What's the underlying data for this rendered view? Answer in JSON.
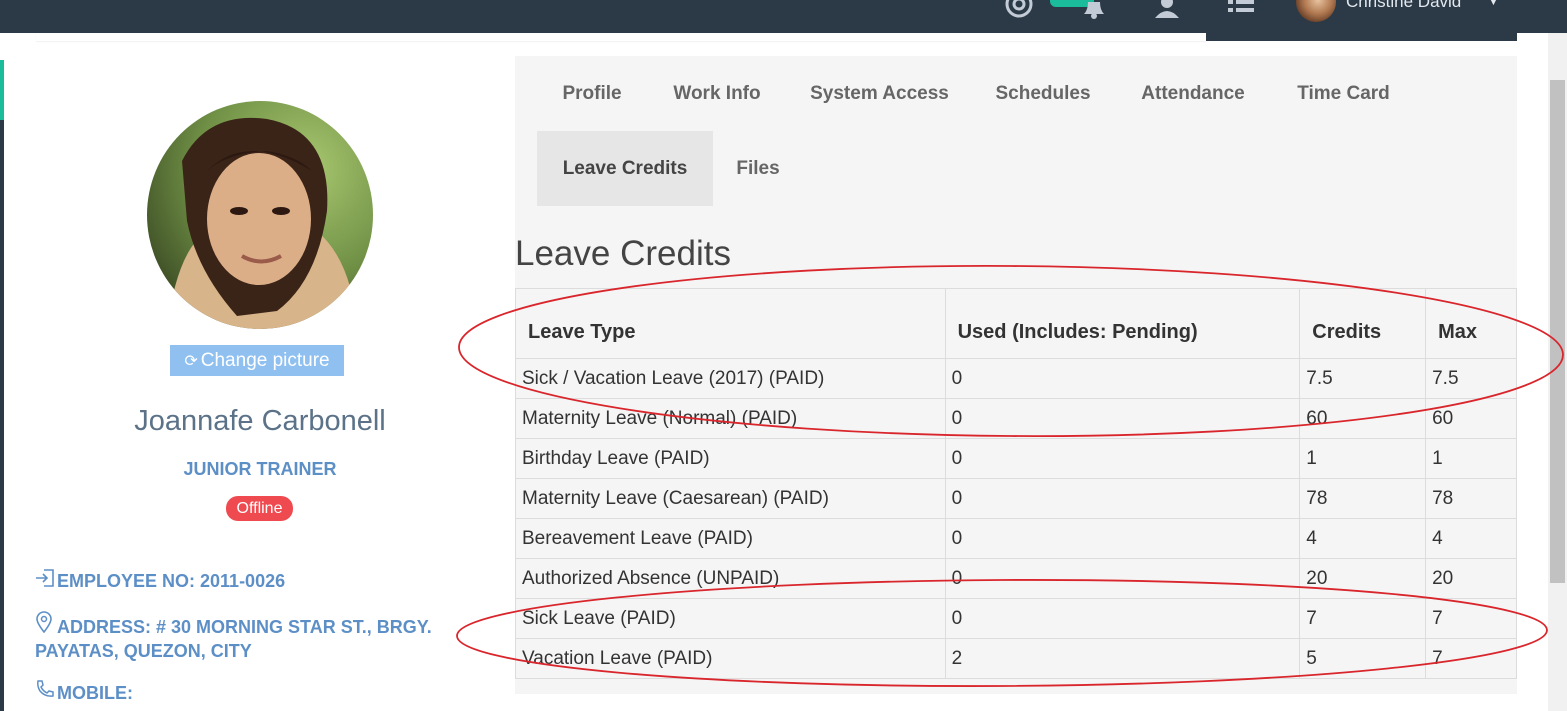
{
  "header": {
    "user_name": "Christine David",
    "icons": [
      "support-icon",
      "bell-icon",
      "users-icon",
      "list-icon",
      "chevron-down-icon"
    ]
  },
  "profile": {
    "change_picture_label": "Change picture",
    "name": "Joannafe Carbonell",
    "title": "JUNIOR TRAINER",
    "status": "Offline",
    "employee_no": "EMPLOYEE NO: 2011-0026",
    "address_line1": "ADDRESS: # 30 MORNING STAR ST., BRGY.",
    "address_line2": "PAYATAS, QUEZON, CITY",
    "mobile": "MOBILE:"
  },
  "tabs": [
    {
      "label": "Profile"
    },
    {
      "label": "Work Info"
    },
    {
      "label": "System Access"
    },
    {
      "label": "Schedules"
    },
    {
      "label": "Attendance"
    },
    {
      "label": "Time Card"
    },
    {
      "label": "Leave Credits",
      "active": true
    },
    {
      "label": "Files"
    }
  ],
  "leave_credits": {
    "title": "Leave Credits",
    "columns": [
      "Leave Type",
      "Used (Includes: Pending)",
      "Credits",
      "Max"
    ],
    "rows": [
      [
        "Sick / Vacation Leave (2017) (PAID)",
        "0",
        "7.5",
        "7.5"
      ],
      [
        "Maternity Leave (Normal) (PAID)",
        "0",
        "60",
        "60"
      ],
      [
        "Birthday Leave (PAID)",
        "0",
        "1",
        "1"
      ],
      [
        "Maternity Leave (Caesarean) (PAID)",
        "0",
        "78",
        "78"
      ],
      [
        "Bereavement Leave (PAID)",
        "0",
        "4",
        "4"
      ],
      [
        "Authorized Absence (UNPAID)",
        "0",
        "20",
        "20"
      ],
      [
        "Sick Leave (PAID)",
        "0",
        "7",
        "7"
      ],
      [
        "Vacation Leave (PAID)",
        "2",
        "5",
        "7"
      ]
    ]
  },
  "colors": {
    "topbar": "#2c3a47",
    "accent": "#1abc9c",
    "link_blue": "#5d8fc7",
    "status_offline": "#ef4a4f",
    "annotation_red": "#d9262c"
  }
}
